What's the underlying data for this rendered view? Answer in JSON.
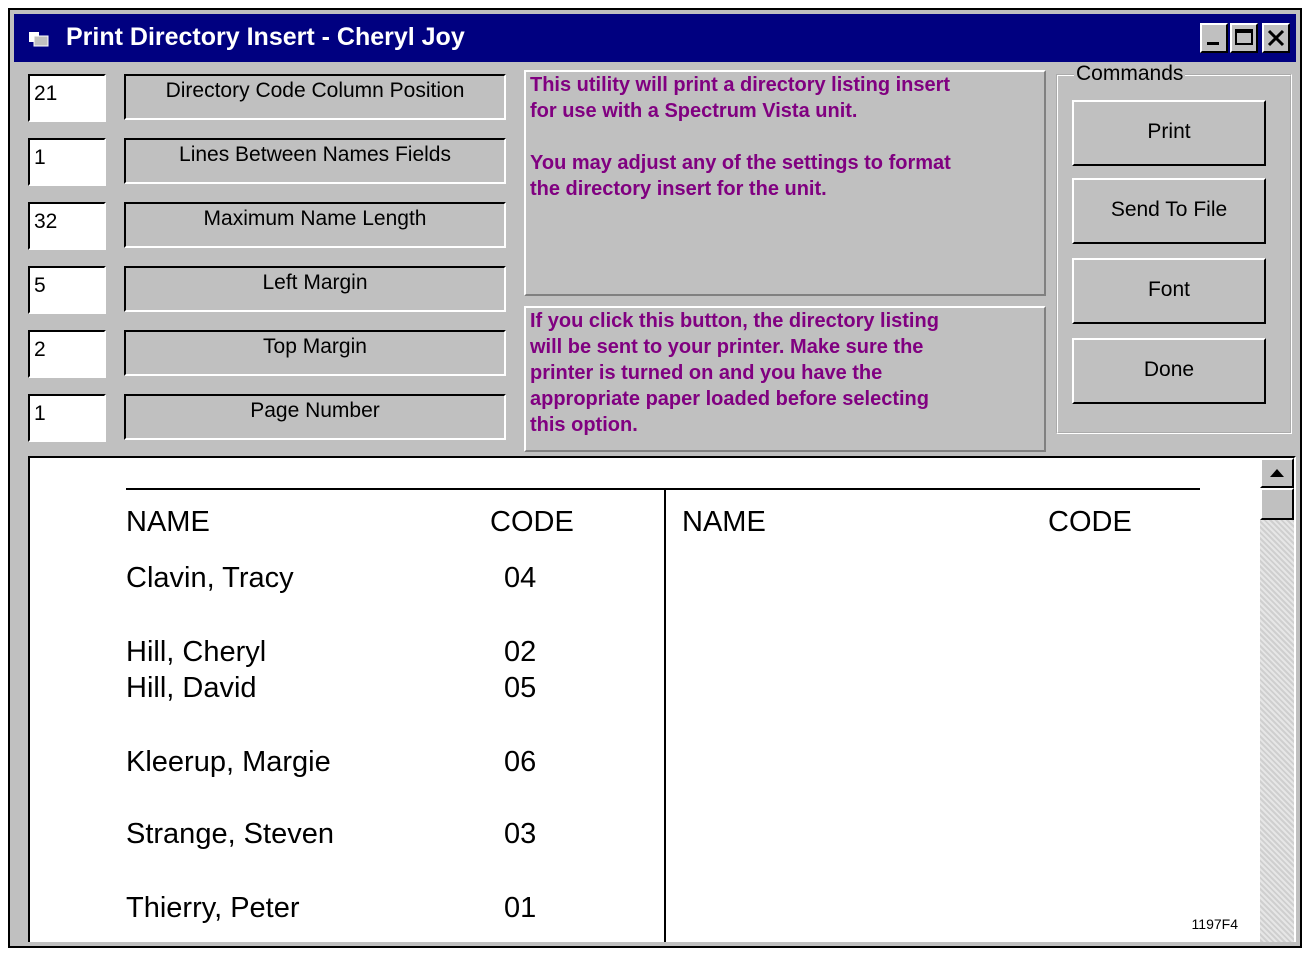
{
  "window": {
    "title": "Print Directory Insert - Cheryl Joy"
  },
  "settings": [
    {
      "value": "21",
      "label": "Directory Code Column Position"
    },
    {
      "value": "1",
      "label": "Lines Between Names Fields"
    },
    {
      "value": "32",
      "label": "Maximum Name Length"
    },
    {
      "value": "5",
      "label": "Left Margin"
    },
    {
      "value": "2",
      "label": "Top Margin"
    },
    {
      "value": "1",
      "label": "Page Number"
    }
  ],
  "info": {
    "intro_line1": "This utility will print a directory listing insert",
    "intro_line2": "for use with a Spectrum Vista unit.",
    "intro_line3": "You may adjust any of the settings to format",
    "intro_line4": "the directory insert for the unit.",
    "help_line1": "If you click this button, the directory listing",
    "help_line2": "will be sent to your printer. Make sure the",
    "help_line3": "printer is turned on and you have the",
    "help_line4": "appropriate paper loaded before selecting",
    "help_line5": "this option."
  },
  "commands": {
    "legend": "Commands",
    "buttons": [
      "Print",
      "Send To File",
      "Font",
      "Done"
    ]
  },
  "preview": {
    "left_name_header": "NAME",
    "left_code_header": "CODE",
    "right_name_header": "NAME",
    "right_code_header": "CODE",
    "entries": [
      {
        "name": "Clavin, Tracy",
        "code": "04"
      },
      {
        "name": "Hill, Cheryl",
        "code": "02"
      },
      {
        "name": "Hill, David",
        "code": "05"
      },
      {
        "name": "Kleerup, Margie",
        "code": "06"
      },
      {
        "name": "Strange, Steven",
        "code": "03"
      },
      {
        "name": "Thierry, Peter",
        "code": "01"
      }
    ],
    "figure_id": "1197F4"
  },
  "colors": {
    "titlebar": "#000080",
    "info_text": "#800080",
    "face": "#c0c0c0"
  }
}
